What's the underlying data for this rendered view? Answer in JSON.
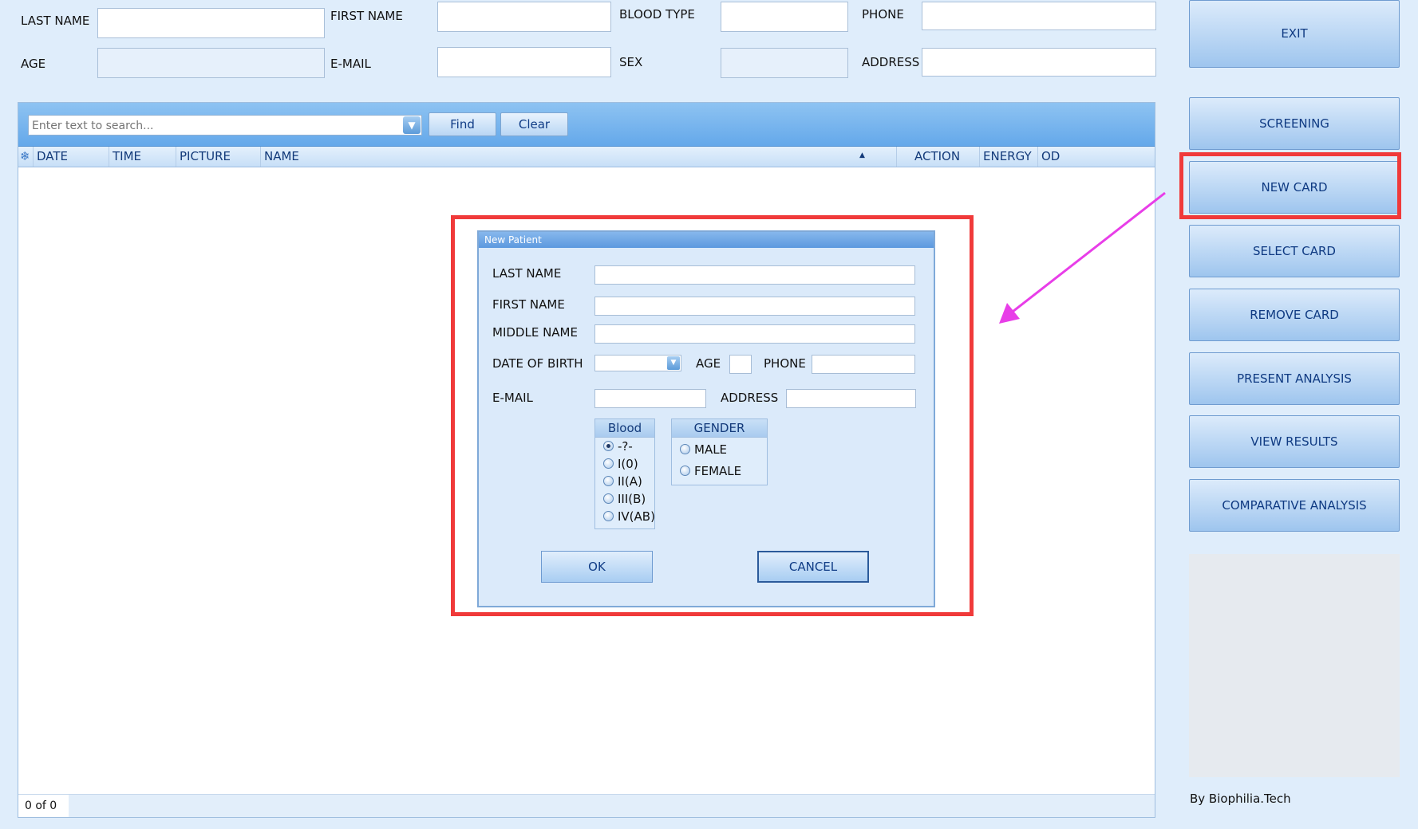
{
  "top_form": {
    "last_name_label": "LAST NAME",
    "first_name_label": "FIRST NAME",
    "blood_type_label": "BLOOD TYPE",
    "phone_label": "PHONE",
    "age_label": "AGE",
    "email_label": "E-MAIL",
    "sex_label": "SEX",
    "address_label": "ADDRESS"
  },
  "grid": {
    "search_placeholder": "Enter text to search...",
    "find_label": "Find",
    "clear_label": "Clear",
    "columns": [
      "DATE",
      "TIME",
      "PICTURE",
      "NAME",
      "ACTION",
      "ENERGY",
      "OD"
    ],
    "status": "0 of 0"
  },
  "side_buttons": {
    "exit": "EXIT",
    "screening": "SCREENING",
    "new_card": "NEW CARD",
    "select_card": "SELECT CARD",
    "remove_card": "REMOVE CARD",
    "present_analysis": "PRESENT ANALYSIS",
    "view_results": "VIEW RESULTS",
    "comparative_analysis": "COMPARATIVE ANALYSIS"
  },
  "credit": "By Biophilia.Tech",
  "dialog": {
    "title": "New Patient",
    "last_name_label": "LAST NAME",
    "first_name_label": "FIRST NAME",
    "middle_name_label": "MIDDLE NAME",
    "dob_label": "DATE OF BIRTH",
    "age_label": "AGE",
    "phone_label": "PHONE",
    "email_label": "E-MAIL",
    "address_label": "ADDRESS",
    "blood_group": {
      "title": "Blood",
      "options": [
        "-?-",
        "I(0)",
        "II(A)",
        "III(B)",
        "IV(AB)"
      ],
      "selected": "-?-"
    },
    "gender_group": {
      "title": "GENDER",
      "options": [
        "MALE",
        "FEMALE"
      ]
    },
    "ok_label": "OK",
    "cancel_label": "CANCEL"
  },
  "colors": {
    "highlight": "#f03a3a",
    "arrow": "#e83ee8",
    "accent": "#0f3a82"
  }
}
